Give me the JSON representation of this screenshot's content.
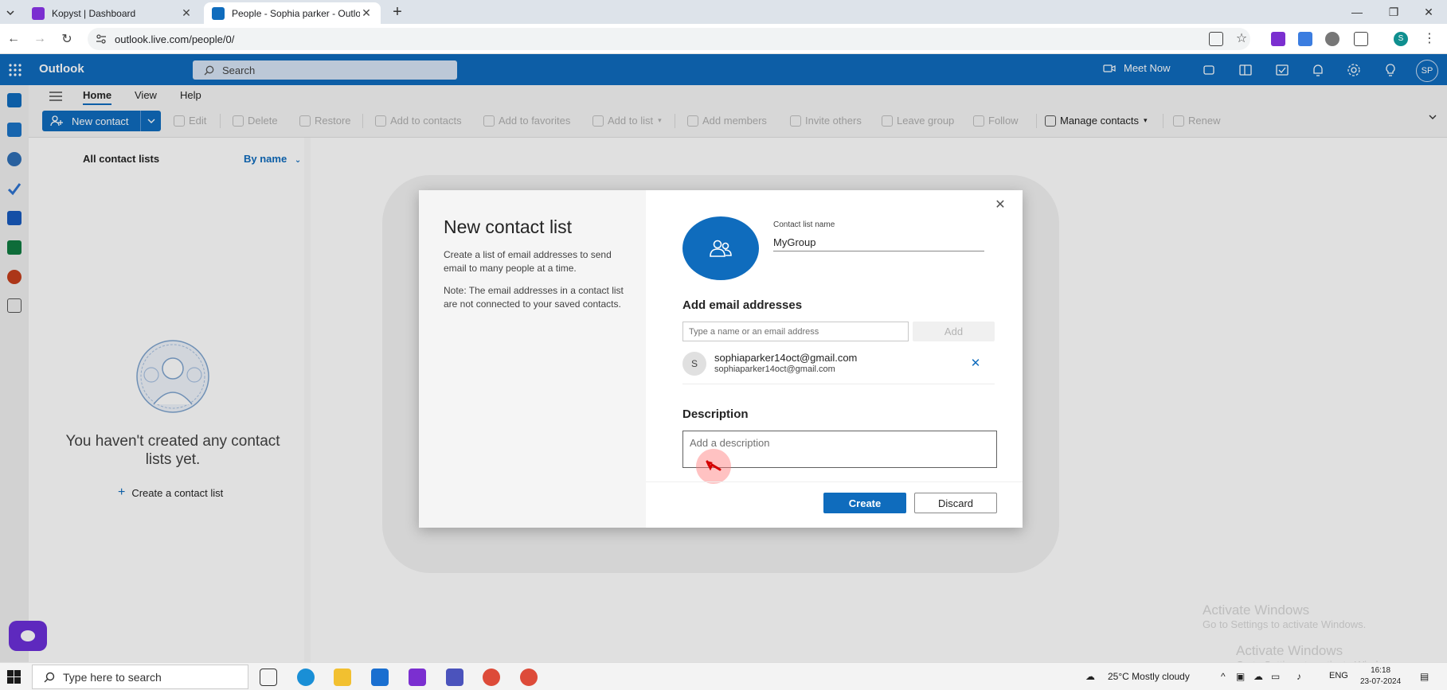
{
  "browser": {
    "tabs": [
      {
        "title": "Kopyst | Dashboard",
        "active": false
      },
      {
        "title": "People - Sophia parker - Outloo",
        "active": true
      }
    ],
    "url": "outlook.live.com/people/0/",
    "profile_initial": "S"
  },
  "outlook": {
    "app_name": "Outlook",
    "search_placeholder": "Search",
    "meet_now": "Meet Now",
    "user_initials": "SP",
    "ribbon_tabs": [
      "Home",
      "View",
      "Help"
    ],
    "new_contact": "New contact",
    "ribbon_buttons": [
      {
        "label": "Edit",
        "enabled": false
      },
      {
        "label": "Delete",
        "enabled": false
      },
      {
        "label": "Restore",
        "enabled": false
      },
      {
        "label": "Add to contacts",
        "enabled": false
      },
      {
        "label": "Add to favorites",
        "enabled": false
      },
      {
        "label": "Add to list",
        "enabled": false
      },
      {
        "label": "Add members",
        "enabled": false
      },
      {
        "label": "Invite others",
        "enabled": false
      },
      {
        "label": "Leave group",
        "enabled": false
      },
      {
        "label": "Follow",
        "enabled": false
      },
      {
        "label": "Manage contacts",
        "enabled": true
      },
      {
        "label": "Renew",
        "enabled": false
      }
    ],
    "left_pane": {
      "title": "All contact lists",
      "sort": "By name",
      "empty_message": "You haven't created any contact lists yet.",
      "create_link": "Create a contact list"
    }
  },
  "dialog": {
    "title": "New contact list",
    "description": "Create a list of email addresses to send email to many people at a time.",
    "note": "Note: The email addresses in a contact list are not connected to your saved contacts.",
    "name_label": "Contact list name",
    "name_value": "MyGroup",
    "add_emails_heading": "Add email addresses",
    "email_placeholder": "Type a name or an email address",
    "add_button": "Add",
    "members": [
      {
        "initial": "S",
        "name": "sophiaparker14oct@gmail.com",
        "email": "sophiaparker14oct@gmail.com"
      }
    ],
    "description_heading": "Description",
    "description_placeholder": "Add a description",
    "create_button": "Create",
    "discard_button": "Discard"
  },
  "watermark": {
    "title": "Activate Windows",
    "subtitle": "Go to Settings to activate Windows."
  },
  "taskbar": {
    "search_placeholder": "Type here to search",
    "weather": "25°C  Mostly cloudy",
    "language": "ENG",
    "time": "16:18",
    "date": "23-07-2024"
  }
}
